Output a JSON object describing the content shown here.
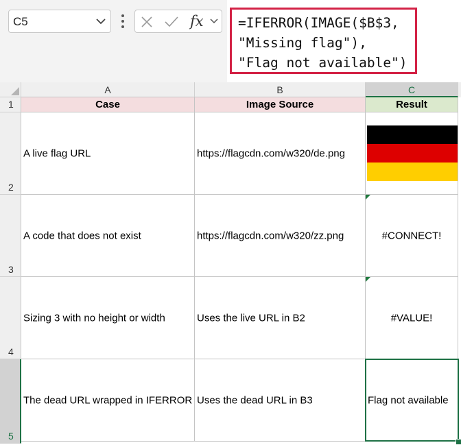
{
  "name_box": {
    "value": "C5"
  },
  "formula_bar": {
    "fx_label": "fx",
    "lines": [
      "=IFERROR(IMAGE($B$3,",
      "\"Missing flag\"),",
      "\"Flag not available\")"
    ]
  },
  "columns": [
    "A",
    "B",
    "C"
  ],
  "rows": [
    {
      "num": "1",
      "a": "Case",
      "b": "Image Source",
      "c": "Result"
    },
    {
      "num": "2",
      "a": "A live flag URL",
      "b": "https://flagcdn.com/w320/de.png",
      "c": ""
    },
    {
      "num": "3",
      "a": "A code that does not exist",
      "b": "https://flagcdn.com/w320/zz.png",
      "c": "#CONNECT!"
    },
    {
      "num": "4",
      "a": "Sizing 3 with no height or width",
      "b": "Uses the live URL in B2",
      "c": "#VALUE!"
    },
    {
      "num": "5",
      "a": "The dead URL wrapped in IFERROR",
      "b": "Uses the dead URL in B3",
      "c": "Flag not available"
    }
  ],
  "selected_cell": "C5",
  "colors": {
    "selection": "#1e7145",
    "formula_highlight": "#d32246",
    "header_pink": "#f4dddf",
    "header_green": "#dbe9cd",
    "flag_black": "#000000",
    "flag_red": "#dd0000",
    "flag_gold": "#ffce00",
    "error_indicator": "#1f7a3e"
  }
}
